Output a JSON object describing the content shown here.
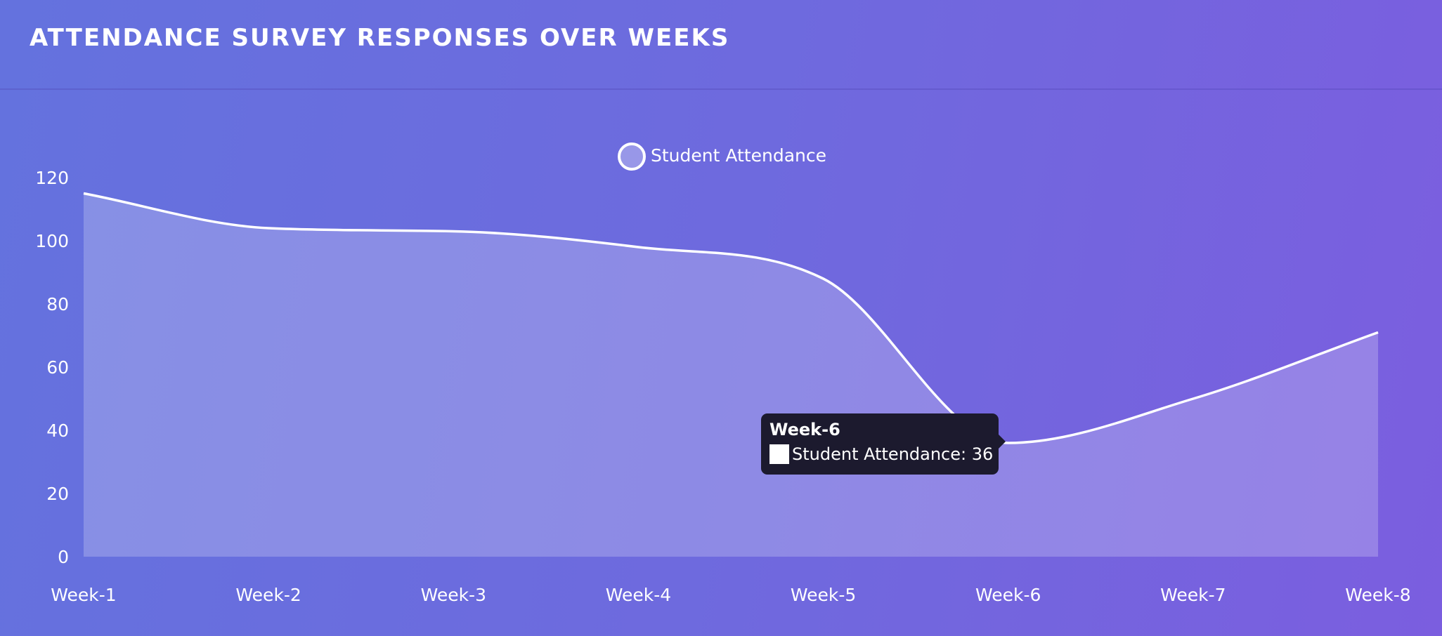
{
  "header": {
    "title": "ATTENDANCE SURVEY RESPONSES OVER WEEKS"
  },
  "tooltip": {
    "title": "Week-6",
    "series": "Student Attendance",
    "value": 36
  },
  "colors": {
    "line": "#ffffff",
    "area_fill": "#ffffff",
    "tooltip_bg": "#1c1a2e"
  },
  "chart_data": {
    "type": "area",
    "title": "ATTENDANCE SURVEY RESPONSES OVER WEEKS",
    "xlabel": "",
    "ylabel": "",
    "categories": [
      "Week-1",
      "Week-2",
      "Week-3",
      "Week-4",
      "Week-5",
      "Week-6",
      "Week-7",
      "Week-8"
    ],
    "series": [
      {
        "name": "Student Attendance",
        "values": [
          115,
          104,
          103,
          98,
          88,
          36,
          50,
          71
        ]
      }
    ],
    "yticks": [
      0,
      20,
      40,
      60,
      80,
      100,
      120
    ],
    "ylim": [
      0,
      120
    ],
    "legend": "top-center",
    "grid": false
  }
}
